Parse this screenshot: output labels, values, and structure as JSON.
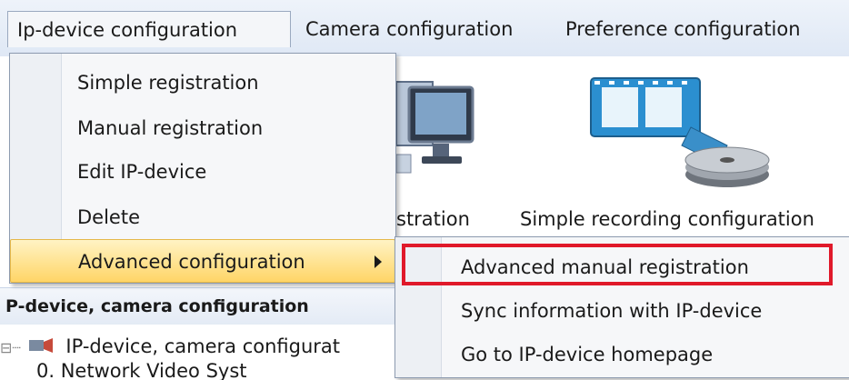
{
  "menubar": {
    "items": [
      {
        "label": "Ip-device configuration"
      },
      {
        "label": "Camera configuration"
      },
      {
        "label": "Preference configuration"
      }
    ]
  },
  "toolbar": {
    "partial_label": "stration",
    "recording_label": "Simple recording configuration"
  },
  "dropdown": {
    "items": [
      {
        "label": "Simple registration"
      },
      {
        "label": "Manual registration"
      },
      {
        "label": "Edit IP-device"
      },
      {
        "label": "Delete"
      },
      {
        "label": "Advanced configuration"
      }
    ]
  },
  "submenu": {
    "items": [
      {
        "label": "Advanced manual registration"
      },
      {
        "label": "Sync information with IP-device"
      },
      {
        "label": "Go to IP-device homepage"
      }
    ]
  },
  "pane": {
    "title": "P-device, camera configuration",
    "tree_root": "IP-device, camera configurat",
    "tree_child": "0. Network Video Syst"
  },
  "colors": {
    "highlight_box": "#e0192a",
    "menu_hover": "#ffd567"
  }
}
